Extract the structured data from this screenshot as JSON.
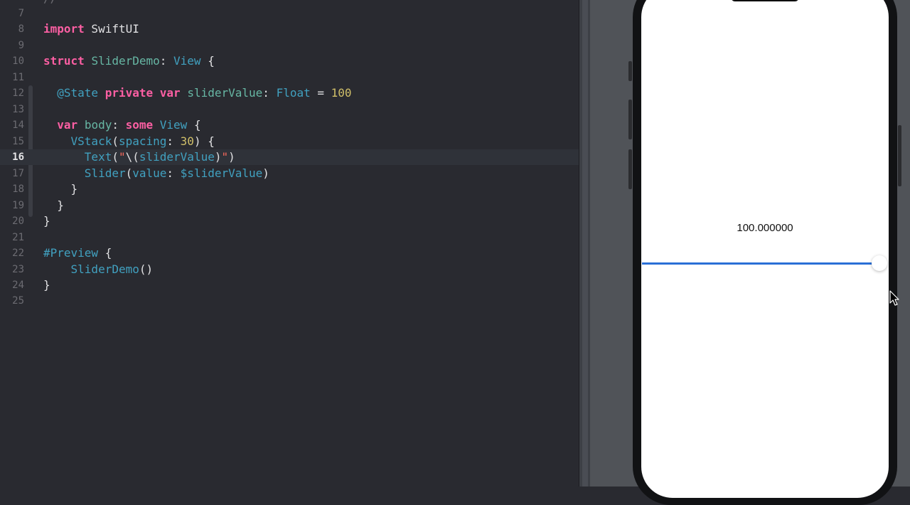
{
  "editor": {
    "top_partial_line": "//",
    "lines": [
      {
        "num": "7",
        "html": ""
      },
      {
        "num": "8",
        "html": "<span class='kw'>import</span> SwiftUI"
      },
      {
        "num": "9",
        "html": ""
      },
      {
        "num": "10",
        "html": "<span class='kw'>struct</span> <span class='nm'>SliderDemo</span>: <span class='ty'>View</span> {"
      },
      {
        "num": "11",
        "html": ""
      },
      {
        "num": "12",
        "html": "  <span class='ty'>@State</span> <span class='kw'>private</span> <span class='kw'>var</span> <span class='nm'>sliderValue</span>: <span class='ty'>Float</span> = <span class='num'>100</span>"
      },
      {
        "num": "13",
        "html": ""
      },
      {
        "num": "14",
        "html": "  <span class='kw'>var</span> <span class='nm'>body</span>: <span class='kw'>some</span> <span class='ty'>View</span> {"
      },
      {
        "num": "15",
        "html": "    <span class='ty'>VStack</span>(<span class='ty'>spacing</span>: <span class='num'>30</span>) {"
      },
      {
        "num": "16",
        "html": "      <span class='ty'>Text</span>(<span class='str'>\"</span>\\(<span class='ty'>sliderValue</span>)<span class='str'>\"</span>)"
      },
      {
        "num": "17",
        "html": "      <span class='ty'>Slider</span>(<span class='ty'>value</span>: <span class='ty'>$sliderValue</span>)"
      },
      {
        "num": "18",
        "html": "    }"
      },
      {
        "num": "19",
        "html": "  }"
      },
      {
        "num": "20",
        "html": "}"
      },
      {
        "num": "21",
        "html": ""
      },
      {
        "num": "22",
        "html": "<span class='ty'>#Preview</span> {"
      },
      {
        "num": "23",
        "html": "    <span class='ty'>SliderDemo</span>()"
      },
      {
        "num": "24",
        "html": "}"
      },
      {
        "num": "25",
        "html": ""
      }
    ],
    "current_line": "16"
  },
  "preview": {
    "text_value": "100.000000",
    "slider": {
      "fraction": 1.0,
      "fill_color": "#2a6fd6"
    },
    "cursor_icon": "mouse-pointer-icon"
  },
  "colors": {
    "editor_bg": "#292a30",
    "keyword": "#fc5fa3",
    "type": "#41a1c0",
    "number": "#d0bf69",
    "string": "#fc6a5d"
  }
}
